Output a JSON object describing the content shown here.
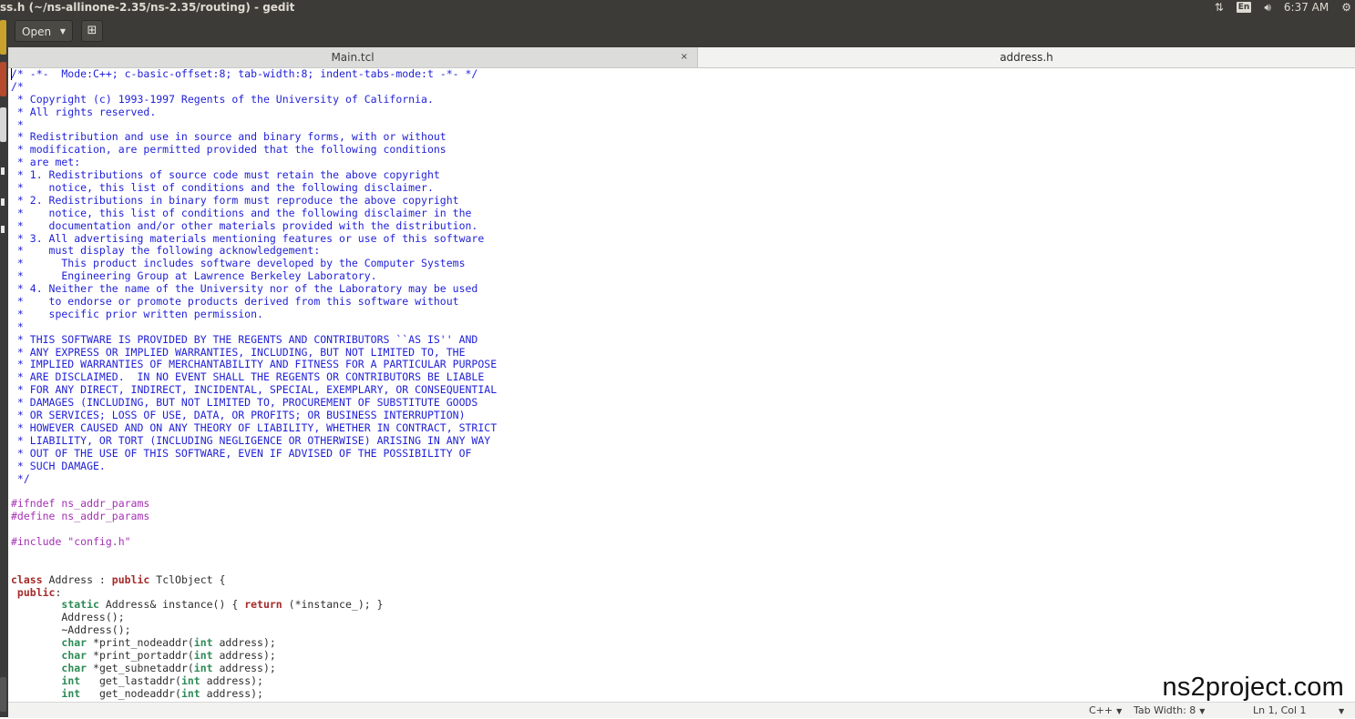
{
  "window": {
    "title": "ss.h (~/ns-allinone-2.35/ns-2.35/routing) - gedit",
    "clock": "6:37 AM",
    "keyboard_layout": "En",
    "icons": [
      "network-arrows-icon",
      "keyboard-icon",
      "volume-icon",
      "power-gear-icon"
    ]
  },
  "toolbar": {
    "open_label": "Open",
    "open_arrow": "▼",
    "new_document_glyph": "⊞"
  },
  "tabs": [
    {
      "label": "Main.tcl",
      "close": "×",
      "active": false
    },
    {
      "label": "address.h",
      "active": true
    }
  ],
  "editor": {
    "lines": [
      [
        [
          "cm",
          "/* -*-  Mode:C++; c-basic-offset:8; tab-width:8; indent-tabs-mode:t -*- */"
        ]
      ],
      [
        [
          "cm",
          "/*"
        ]
      ],
      [
        [
          "cm",
          " * Copyright (c) 1993-1997 Regents of the University of California."
        ]
      ],
      [
        [
          "cm",
          " * All rights reserved."
        ]
      ],
      [
        [
          "cm",
          " *"
        ]
      ],
      [
        [
          "cm",
          " * Redistribution and use in source and binary forms, with or without"
        ]
      ],
      [
        [
          "cm",
          " * modification, are permitted provided that the following conditions"
        ]
      ],
      [
        [
          "cm",
          " * are met:"
        ]
      ],
      [
        [
          "cm",
          " * 1. Redistributions of source code must retain the above copyright"
        ]
      ],
      [
        [
          "cm",
          " *    notice, this list of conditions and the following disclaimer."
        ]
      ],
      [
        [
          "cm",
          " * 2. Redistributions in binary form must reproduce the above copyright"
        ]
      ],
      [
        [
          "cm",
          " *    notice, this list of conditions and the following disclaimer in the"
        ]
      ],
      [
        [
          "cm",
          " *    documentation and/or other materials provided with the distribution."
        ]
      ],
      [
        [
          "cm",
          " * 3. All advertising materials mentioning features or use of this software"
        ]
      ],
      [
        [
          "cm",
          " *    must display the following acknowledgement:"
        ]
      ],
      [
        [
          "cm",
          " *      This product includes software developed by the Computer Systems"
        ]
      ],
      [
        [
          "cm",
          " *      Engineering Group at Lawrence Berkeley Laboratory."
        ]
      ],
      [
        [
          "cm",
          " * 4. Neither the name of the University nor of the Laboratory may be used"
        ]
      ],
      [
        [
          "cm",
          " *    to endorse or promote products derived from this software without"
        ]
      ],
      [
        [
          "cm",
          " *    specific prior written permission."
        ]
      ],
      [
        [
          "cm",
          " *"
        ]
      ],
      [
        [
          "cm",
          " * THIS SOFTWARE IS PROVIDED BY THE REGENTS AND CONTRIBUTORS ``AS IS'' AND"
        ]
      ],
      [
        [
          "cm",
          " * ANY EXPRESS OR IMPLIED WARRANTIES, INCLUDING, BUT NOT LIMITED TO, THE"
        ]
      ],
      [
        [
          "cm",
          " * IMPLIED WARRANTIES OF MERCHANTABILITY AND FITNESS FOR A PARTICULAR PURPOSE"
        ]
      ],
      [
        [
          "cm",
          " * ARE DISCLAIMED.  IN NO EVENT SHALL THE REGENTS OR CONTRIBUTORS BE LIABLE"
        ]
      ],
      [
        [
          "cm",
          " * FOR ANY DIRECT, INDIRECT, INCIDENTAL, SPECIAL, EXEMPLARY, OR CONSEQUENTIAL"
        ]
      ],
      [
        [
          "cm",
          " * DAMAGES (INCLUDING, BUT NOT LIMITED TO, PROCUREMENT OF SUBSTITUTE GOODS"
        ]
      ],
      [
        [
          "cm",
          " * OR SERVICES; LOSS OF USE, DATA, OR PROFITS; OR BUSINESS INTERRUPTION)"
        ]
      ],
      [
        [
          "cm",
          " * HOWEVER CAUSED AND ON ANY THEORY OF LIABILITY, WHETHER IN CONTRACT, STRICT"
        ]
      ],
      [
        [
          "cm",
          " * LIABILITY, OR TORT (INCLUDING NEGLIGENCE OR OTHERWISE) ARISING IN ANY WAY"
        ]
      ],
      [
        [
          "cm",
          " * OUT OF THE USE OF THIS SOFTWARE, EVEN IF ADVISED OF THE POSSIBILITY OF"
        ]
      ],
      [
        [
          "cm",
          " * SUCH DAMAGE."
        ]
      ],
      [
        [
          "cm",
          " */"
        ]
      ],
      [],
      [
        [
          "pp",
          "#ifndef ns_addr_params"
        ]
      ],
      [
        [
          "pp",
          "#define ns_addr_params"
        ]
      ],
      [],
      [
        [
          "pp",
          "#include \"config.h\""
        ]
      ],
      [],
      [],
      [
        [
          "kw",
          "class"
        ],
        [
          "pl",
          " Address : "
        ],
        [
          "kw",
          "public"
        ],
        [
          "pl",
          " TclObject {"
        ]
      ],
      [
        [
          "kw",
          " public"
        ],
        [
          "pl",
          ":"
        ]
      ],
      [
        [
          "pl",
          "        "
        ],
        [
          "ty",
          "static"
        ],
        [
          "pl",
          " Address& instance() { "
        ],
        [
          "kw",
          "return"
        ],
        [
          "pl",
          " (*instance_); }"
        ]
      ],
      [
        [
          "pl",
          "        Address();"
        ]
      ],
      [
        [
          "pl",
          "        ~Address();"
        ]
      ],
      [
        [
          "pl",
          "        "
        ],
        [
          "ty",
          "char"
        ],
        [
          "pl",
          " *print_nodeaddr("
        ],
        [
          "ty",
          "int"
        ],
        [
          "pl",
          " address);"
        ]
      ],
      [
        [
          "pl",
          "        "
        ],
        [
          "ty",
          "char"
        ],
        [
          "pl",
          " *print_portaddr("
        ],
        [
          "ty",
          "int"
        ],
        [
          "pl",
          " address);"
        ]
      ],
      [
        [
          "pl",
          "        "
        ],
        [
          "ty",
          "char"
        ],
        [
          "pl",
          " *get_subnetaddr("
        ],
        [
          "ty",
          "int"
        ],
        [
          "pl",
          " address);"
        ]
      ],
      [
        [
          "pl",
          "        "
        ],
        [
          "ty",
          "int"
        ],
        [
          "pl",
          "   get_lastaddr("
        ],
        [
          "ty",
          "int"
        ],
        [
          "pl",
          " address);"
        ]
      ],
      [
        [
          "pl",
          "        "
        ],
        [
          "ty",
          "int"
        ],
        [
          "pl",
          "   get_nodeaddr("
        ],
        [
          "ty",
          "int"
        ],
        [
          "pl",
          " address);"
        ]
      ]
    ]
  },
  "watermark": "ns2project.com",
  "statusbar": {
    "language": "C++",
    "tab_width": "Tab Width: 8",
    "position": "Ln 1, Col 1",
    "arrow": "▼"
  }
}
